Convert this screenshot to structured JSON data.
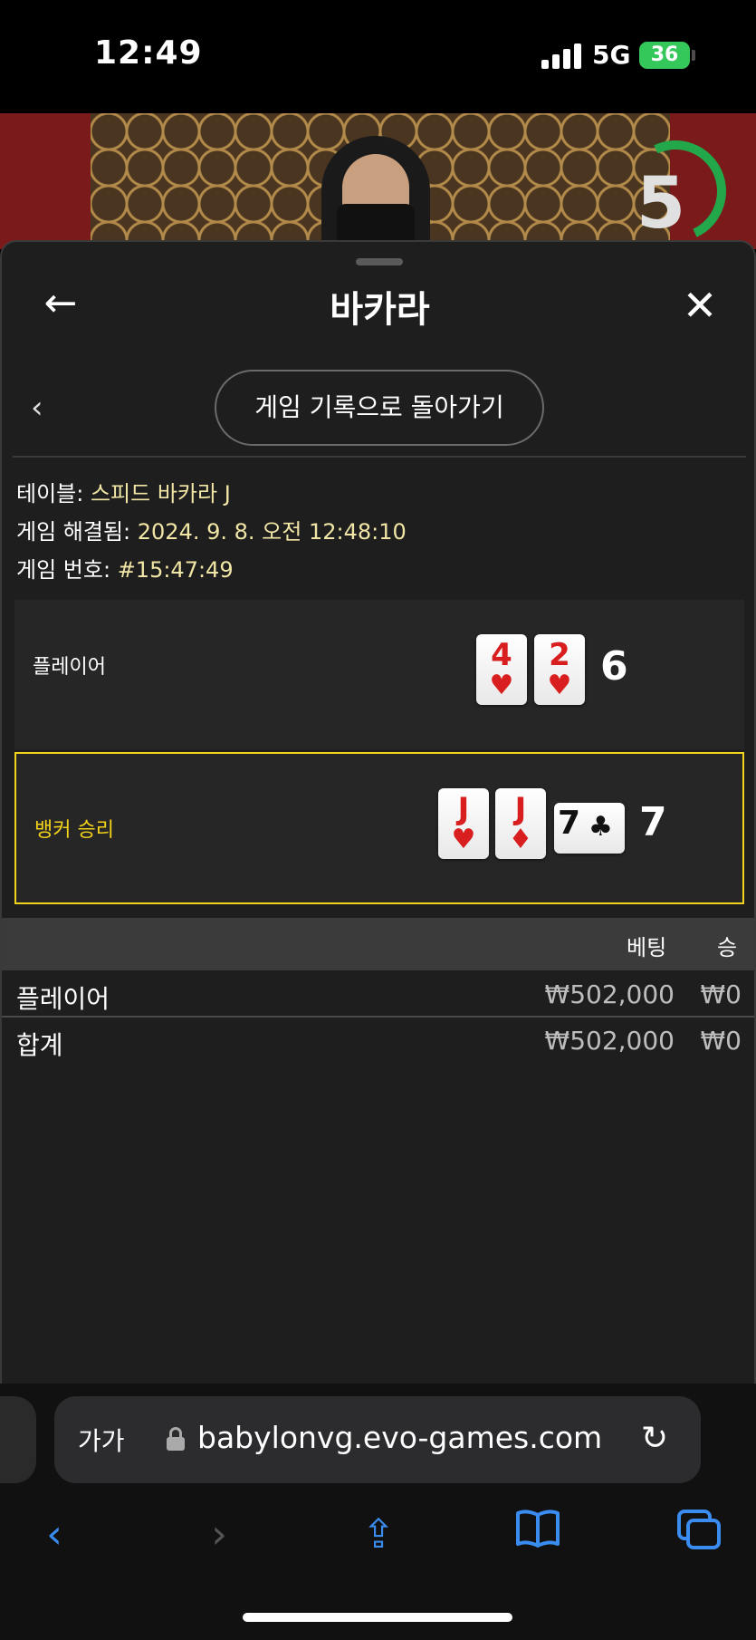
{
  "status_bar": {
    "time": "12:49",
    "network": "5G",
    "battery": "36"
  },
  "video": {
    "countdown": "5"
  },
  "header": {
    "title": "바카라",
    "back_icon": "←",
    "close_icon": "✕"
  },
  "nav": {
    "return_label": "게임 기록으로 돌아가기",
    "chevron": "‹"
  },
  "info": {
    "table_label": "테이블:",
    "table_value": "스피드 바카라 J",
    "resolved_label": "게임 해결됨:",
    "resolved_value": "2024. 9. 8. 오전 12:48:10",
    "number_label": "게임 번호:",
    "number_value": "#15:47:49"
  },
  "player_hand": {
    "label": "플레이어",
    "score": "6",
    "cards": [
      {
        "rank": "4",
        "suit": "♥"
      },
      {
        "rank": "2",
        "suit": "♥"
      }
    ]
  },
  "banker_hand": {
    "label": "뱅커 승리",
    "score": "7",
    "cards": [
      {
        "rank": "J",
        "suit": "♥"
      },
      {
        "rank": "J",
        "suit": "♦"
      },
      {
        "rank": "7",
        "suit": "♣"
      }
    ]
  },
  "bets_table": {
    "headers": {
      "bet": "베팅",
      "win": "승"
    },
    "rows": [
      {
        "name": "플레이어",
        "bet": "₩502,000",
        "win": "₩0"
      },
      {
        "name": "합계",
        "bet": "₩502,000",
        "win": "₩0"
      }
    ]
  },
  "browser": {
    "aa": "가가",
    "url": "babylonvg.evo-games.com",
    "reload_icon": "↻"
  },
  "toolbar": {
    "back": "‹",
    "forward": "›",
    "share": "⇪",
    "bookmarks": "📖",
    "tabs": "⧉"
  },
  "colors": {
    "winner": "#f2d21a",
    "info_value": "#f1e6a6",
    "accent": "#3a8cf0",
    "card_red": "#d81e1e"
  }
}
